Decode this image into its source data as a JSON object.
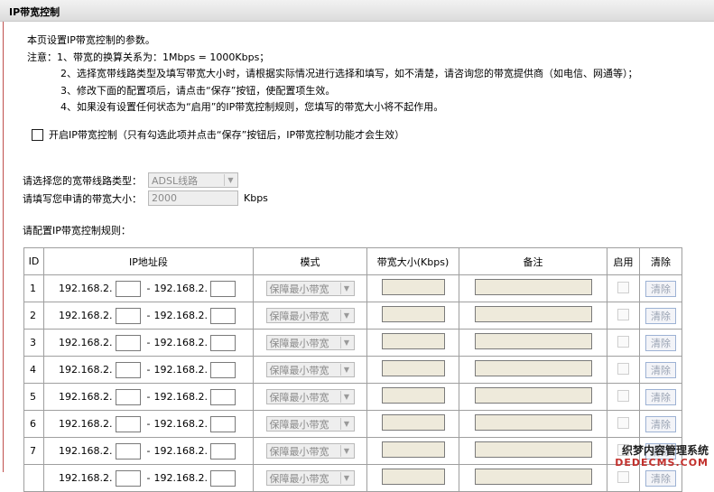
{
  "page_title": "IP带宽控制",
  "intro": {
    "line1": "本页设置IP带宽控制的参数。",
    "line2": "注意：1、带宽的换算关系为：1Mbps = 1000Kbps；",
    "line3": "2、选择宽带线路类型及填写带宽大小时，请根据实际情况进行选择和填写，如不清楚，请咨询您的带宽提供商（如电信、网通等）；",
    "line4": "3、修改下面的配置项后，请点击“保存”按钮，使配置项生效。",
    "line5": "4、如果没有设置任何状态为“启用”的IP带宽控制规则，您填写的带宽大小将不起作用。"
  },
  "enable": {
    "label": "开启IP带宽控制（只有勾选此项并点击“保存”按钮后，IP带宽控制功能才会生效）",
    "checked": false
  },
  "line_type": {
    "label": "请选择您的宽带线路类型：",
    "value": "ADSL线路"
  },
  "bandwidth": {
    "label": "请填写您申请的带宽大小：",
    "value": "2000",
    "unit": "Kbps"
  },
  "rules_label": "请配置IP带宽控制规则：",
  "table": {
    "headers": {
      "id": "ID",
      "ip": "IP地址段",
      "mode": "模式",
      "bw": "带宽大小(Kbps)",
      "note": "备注",
      "enable": "启用",
      "clear": "清除"
    },
    "ip_prefix": "192.168.2.",
    "separator": "-",
    "mode_value": "保障最小带宽",
    "clear_label": "清除",
    "rows": [
      {
        "id": "1"
      },
      {
        "id": "2"
      },
      {
        "id": "3"
      },
      {
        "id": "4"
      },
      {
        "id": "5"
      },
      {
        "id": "6"
      },
      {
        "id": "7"
      },
      {
        "id": ""
      }
    ]
  },
  "watermark": {
    "line1": "织梦内容管理系统",
    "line2": "DEDECMS.COM"
  }
}
